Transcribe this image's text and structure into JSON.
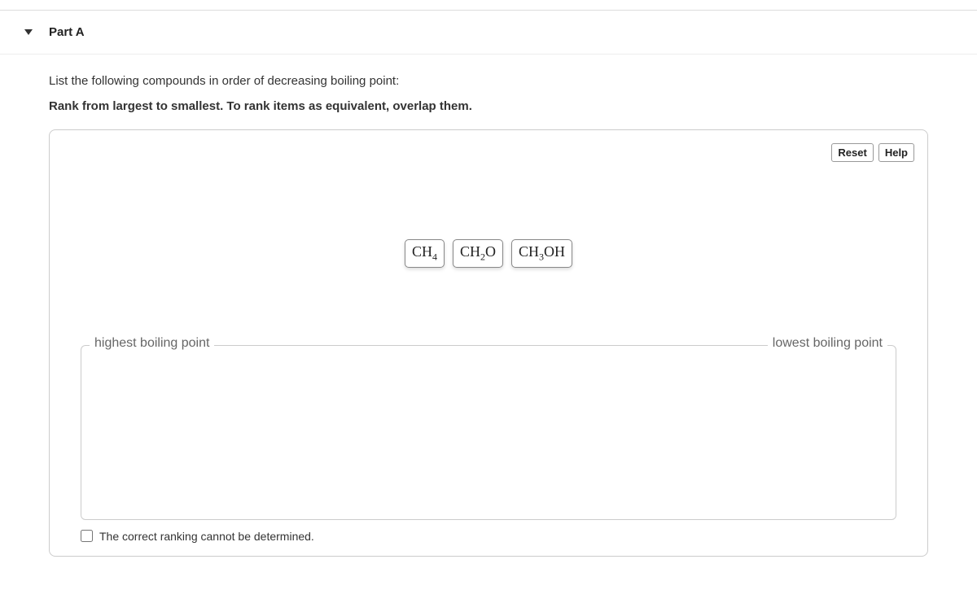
{
  "part": {
    "label": "Part A"
  },
  "prompts": {
    "line1": "List the following compounds in order of decreasing boiling point:",
    "line2": "Rank from largest to smallest. To rank items as equivalent, overlap them."
  },
  "controls": {
    "reset": "Reset",
    "help": "Help"
  },
  "compounds": {
    "c1": "CH₄",
    "c2": "CH₂O",
    "c3": "CH₃OH"
  },
  "ranking": {
    "left_label": "highest boiling point",
    "right_label": "lowest boiling point"
  },
  "undetermined": {
    "label": "The correct ranking cannot be determined."
  }
}
